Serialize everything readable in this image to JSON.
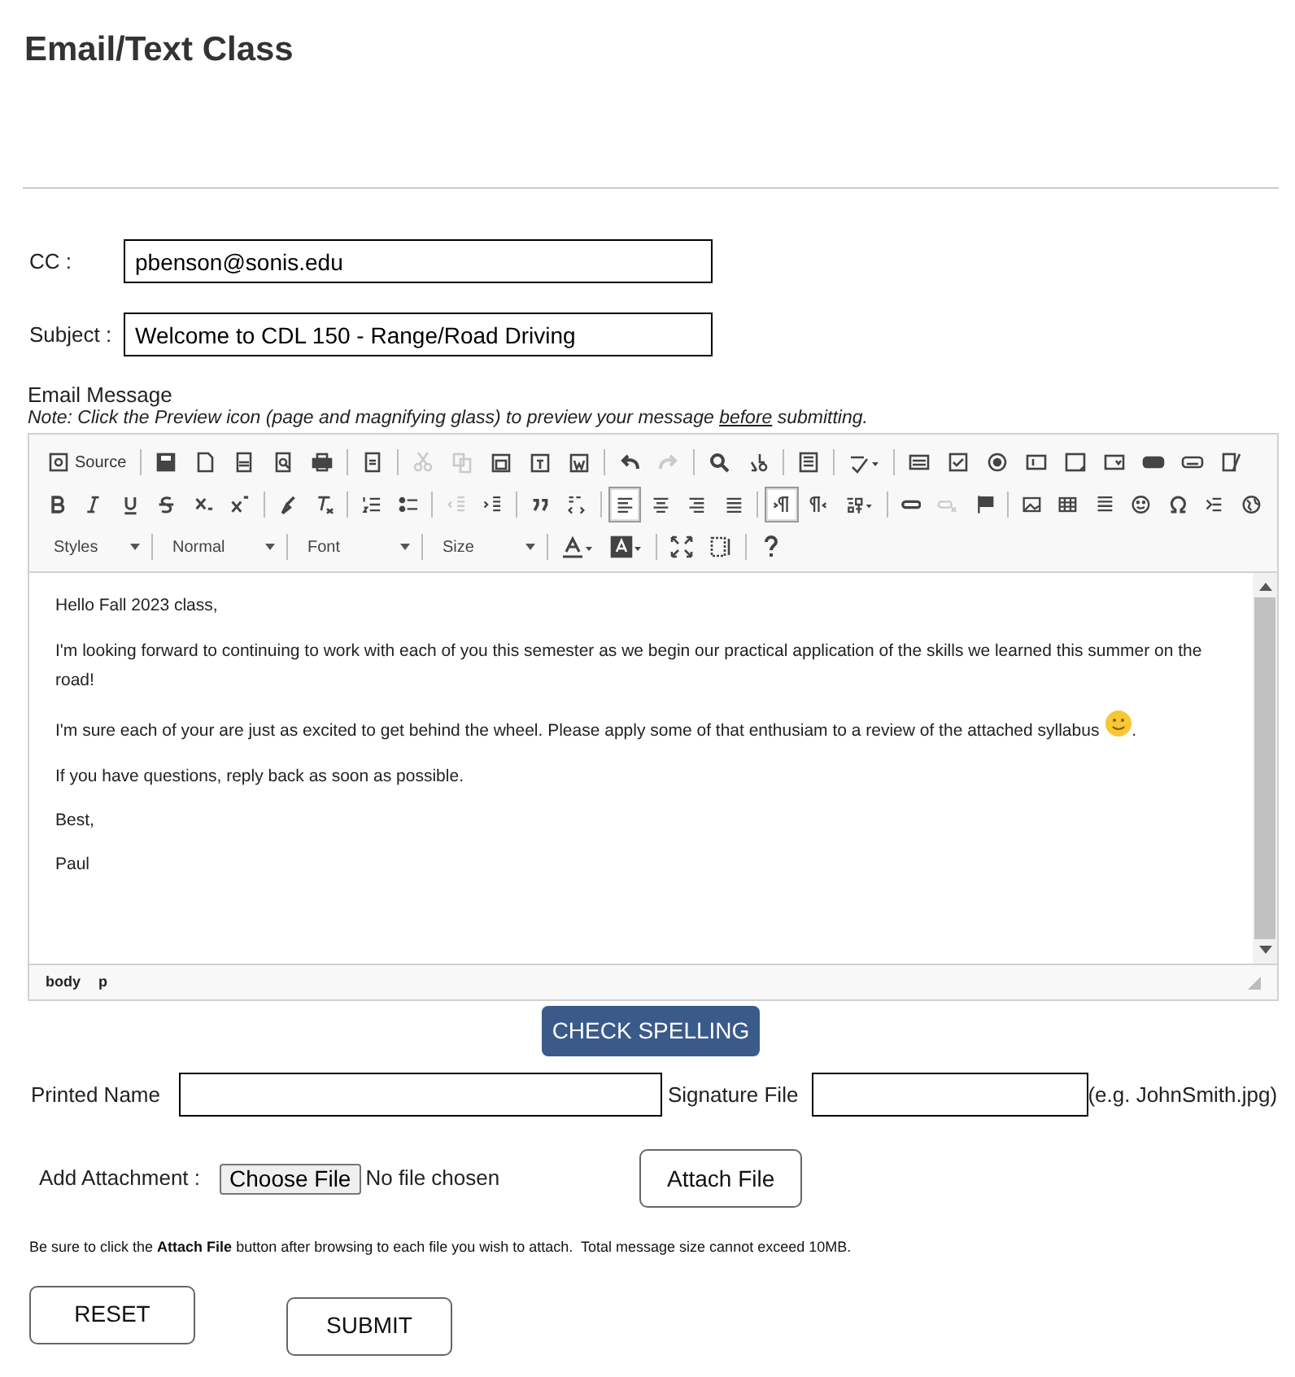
{
  "title": "Email/Text Class",
  "cc": {
    "label": "CC :",
    "value": "pbenson@sonis.edu"
  },
  "subject": {
    "label": "Subject :",
    "value": "Welcome to CDL 150 - Range/Road Driving"
  },
  "message": {
    "label": "Email Message",
    "note": {
      "text": "Note: Click the Preview icon (page and magnifying glass) to preview your message ",
      "underlined": "before",
      "text_after": " submitting."
    }
  },
  "toolbar": {
    "rows": [
      [
        {
          "label": "Source",
          "selected": false,
          "disabled": false
        },
        {
          "selected": false,
          "disabled": false
        },
        {
          "selected": false,
          "disabled": false
        },
        {
          "selected": false,
          "disabled": false
        },
        {
          "selected": false,
          "disabled": false
        },
        {
          "selected": false,
          "disabled": false
        },
        {
          "selected": false,
          "disabled": false
        },
        {
          "selected": false,
          "disabled": true
        },
        {
          "selected": false,
          "disabled": true
        },
        {
          "selected": false,
          "disabled": false
        },
        {
          "selected": false,
          "disabled": false
        },
        {
          "selected": false,
          "disabled": false
        },
        {
          "selected": false,
          "disabled": false
        },
        {
          "selected": false,
          "disabled": true
        },
        {
          "selected": false,
          "disabled": false
        },
        {
          "selected": false,
          "disabled": false
        },
        {
          "selected": false,
          "disabled": false
        },
        {
          "selected": false,
          "disabled": false
        },
        {
          "selected": false,
          "disabled": false
        },
        {
          "selected": false,
          "disabled": false
        },
        {
          "selected": false,
          "disabled": false
        },
        {
          "selected": false,
          "disabled": false
        },
        {
          "selected": false,
          "disabled": false
        },
        {
          "selected": false,
          "disabled": false
        },
        {
          "selected": false,
          "disabled": false
        },
        {
          "selected": false,
          "disabled": false
        },
        {
          "selected": false,
          "disabled": false
        }
      ],
      [
        {
          "selected": false,
          "disabled": false
        },
        {
          "selected": false,
          "disabled": false
        },
        {
          "selected": false,
          "disabled": false
        },
        {
          "selected": false,
          "disabled": false
        },
        {
          "selected": false,
          "disabled": false
        },
        {
          "selected": false,
          "disabled": false
        },
        {
          "selected": false,
          "disabled": false
        },
        {
          "selected": false,
          "disabled": false
        },
        {
          "selected": false,
          "disabled": false
        },
        {
          "selected": false,
          "disabled": false
        },
        {
          "selected": false,
          "disabled": true
        },
        {
          "selected": false,
          "disabled": false
        },
        {
          "selected": false,
          "disabled": false
        },
        {
          "selected": false,
          "disabled": false
        },
        {
          "selected": true,
          "disabled": false
        },
        {
          "selected": false,
          "disabled": false
        },
        {
          "selected": false,
          "disabled": false
        },
        {
          "selected": false,
          "disabled": false
        },
        {
          "selected": true,
          "disabled": false
        },
        {
          "selected": false,
          "disabled": false
        },
        {
          "selected": false,
          "disabled": false
        },
        {
          "selected": false,
          "disabled": false
        },
        {
          "selected": false,
          "disabled": true
        },
        {
          "selected": false,
          "disabled": false
        },
        {
          "selected": false,
          "disabled": false
        },
        {
          "selected": false,
          "disabled": false
        },
        {
          "selected": false,
          "disabled": false
        },
        {
          "selected": false,
          "disabled": false
        },
        {
          "selected": false,
          "disabled": false
        },
        {
          "selected": false,
          "disabled": false
        },
        {
          "selected": false,
          "disabled": false
        }
      ],
      [
        {
          "selected": false,
          "disabled": false
        },
        {
          "selected": false,
          "disabled": false
        },
        {
          "selected": false,
          "disabled": false
        },
        {
          "selected": false,
          "disabled": false
        },
        {
          "selected": false,
          "disabled": false
        }
      ]
    ],
    "combos": [
      "Styles",
      "Normal",
      "Font",
      "Size"
    ]
  },
  "body": [
    {
      "text": "Hello Fall 2023 class,"
    },
    {
      "text": "I'm looking forward to continuing to work with each of you this semester as we begin our practical application of the skills we learned this summer on the road!"
    },
    {
      "text": "I'm sure each of your are just as excited to get behind the wheel. Please apply some of that enthusiam to a review of the attached syllabus ",
      "emoticon": true,
      "text_after": "."
    },
    {
      "text": "If you have questions, reply back as soon as possible."
    },
    {
      "text": "Best,"
    },
    {
      "text": "Paul"
    }
  ],
  "path": [
    "body",
    "p"
  ],
  "check_spelling": "CHECK SPELLING",
  "printed_name": {
    "label": "Printed Name"
  },
  "signature": {
    "label": "Signature File",
    "hint": "(e.g. JohnSmith.jpg)"
  },
  "attachment": {
    "label": "Add Attachment :",
    "choose": "Choose File",
    "status": "No file chosen",
    "attach": "Attach File"
  },
  "notice": "Be sure to click the **Attach File** button after browsing to each file you wish to attach.  Total message size cannot exceed 10MB.",
  "buttons": [
    "RESET",
    "SUBMIT"
  ]
}
